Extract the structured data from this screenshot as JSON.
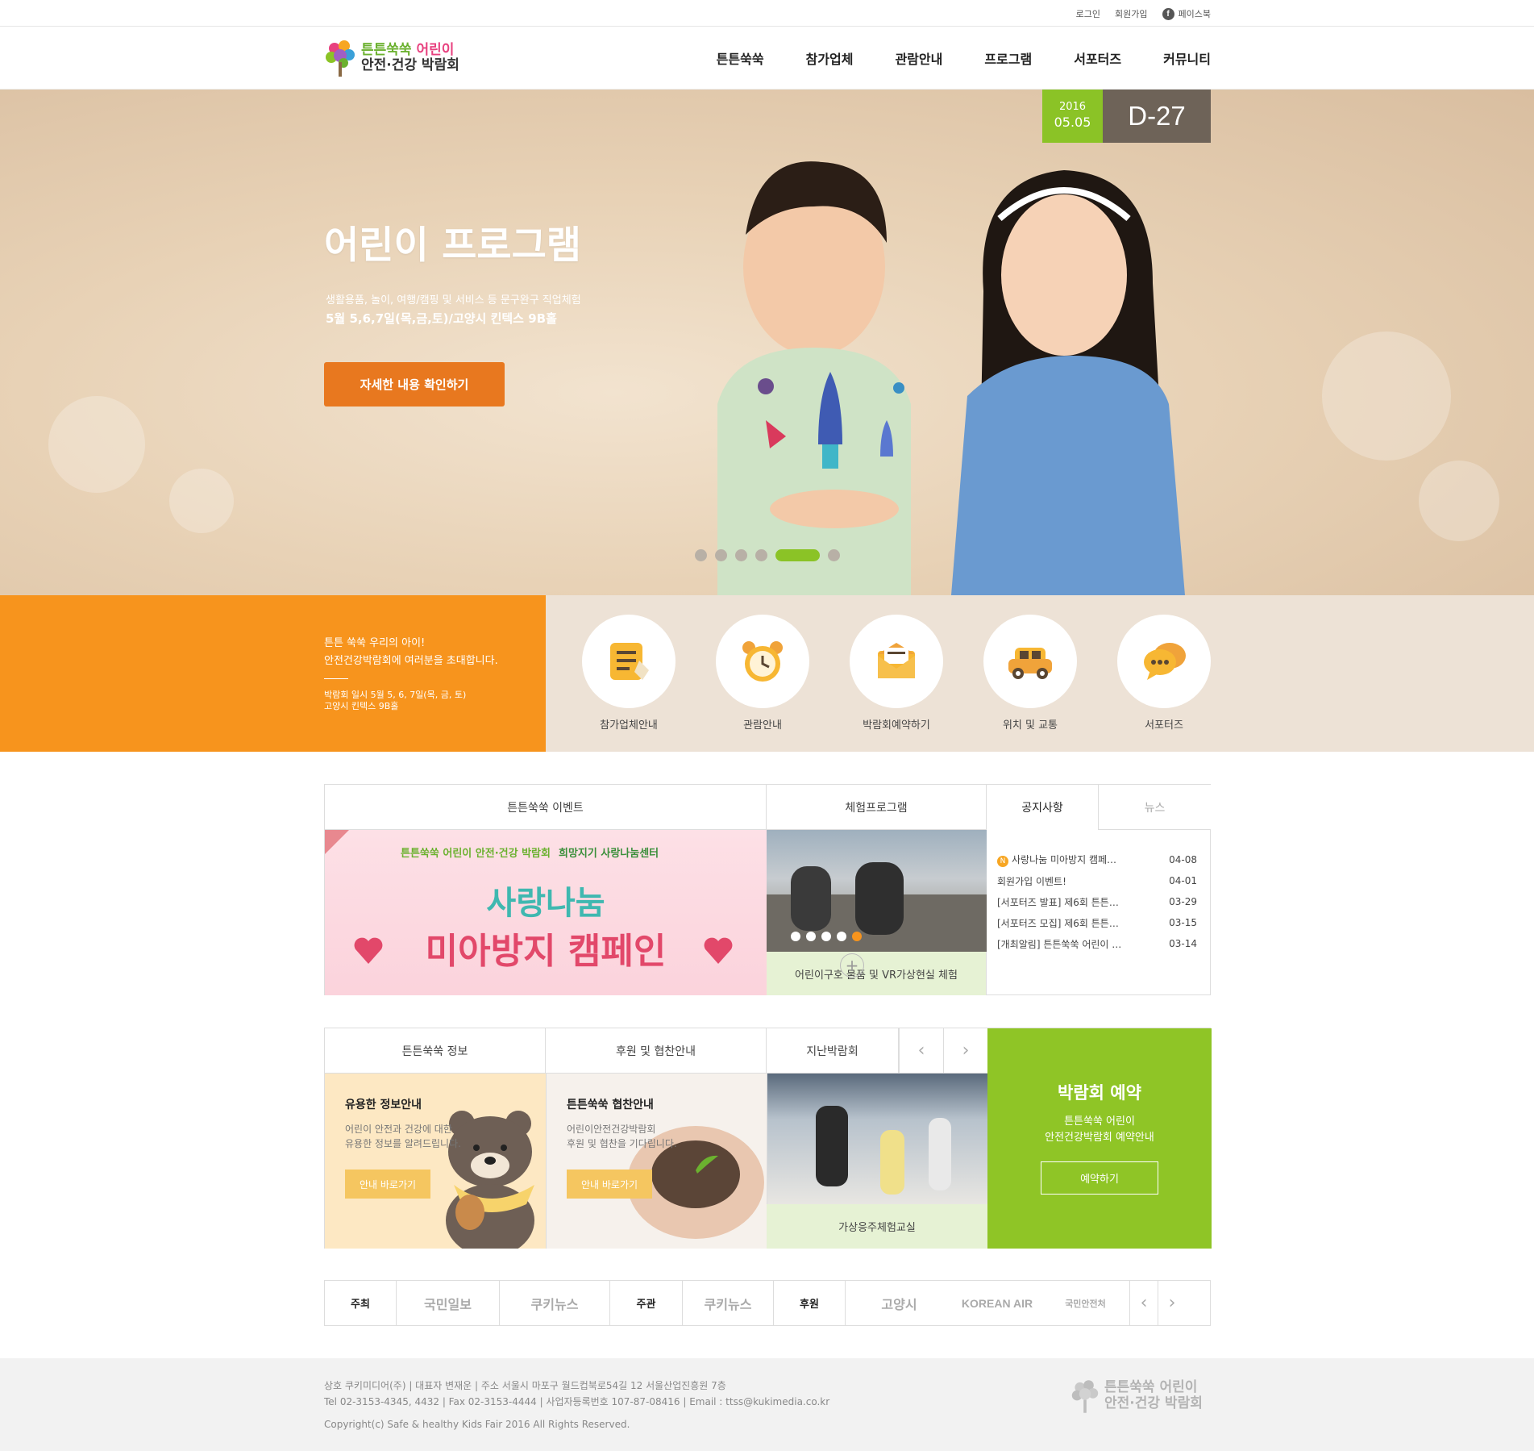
{
  "util": {
    "login": "로그인",
    "join": "회원가입",
    "facebook": "페이스북"
  },
  "logo": {
    "line1a": "튼튼쑥쑥",
    "line1b": "어린이",
    "line2": "안전·건강 박람회"
  },
  "gnb": [
    "튼튼쑥쑥",
    "참가업체",
    "관람안내",
    "프로그램",
    "서포터즈",
    "커뮤니티"
  ],
  "hero": {
    "title": "어린이 프로그램",
    "sub1": "생활용품, 놀이, 여행/캠핑 및 서비스 등 문구완구 직업체험",
    "sub2": "5월 5,6,7일(목,금,토)/고양시 킨텍스 9B홀",
    "button": "자세한 내용 확인하기",
    "dday_year": "2016",
    "dday_date": "05.05",
    "dday_count": "D-27",
    "slides_total": 6,
    "slide_active": 5
  },
  "quick": {
    "intro1": "튼튼 쑥쑥 우리의 아이!",
    "intro2": "안전건강박람회에 여러분을 초대합니다.",
    "info1": "박람회 일시 5월 5, 6, 7일(목, 금, 토)",
    "info2": "고양시 킨텍스 9B홀",
    "items": [
      "참가업체안내",
      "관람안내",
      "박람회예약하기",
      "위치 및 교통",
      "서포터즈"
    ]
  },
  "board": {
    "tab_event": "튼튼쑥쑥 이벤트",
    "tab_exp": "체험프로그램",
    "tab_notice": "공지사항",
    "tab_news": "뉴스",
    "event_header": "튼튼쑥쑥 어린이 안전·건강 박람회",
    "event_partner": "희망지기 사랑나눔센터",
    "event_title1": "사랑나눔",
    "event_title2": "미아방지 캠페인",
    "exp_caption": "어린이구호 물품 및 VR가상현실 체험",
    "notices": [
      {
        "badge": "N",
        "title": "사랑나눔 미아방지 캠페…",
        "date": "04-08"
      },
      {
        "badge": "",
        "title": "회원가입 이벤트!",
        "date": "04-01"
      },
      {
        "badge": "",
        "title": "[서포터즈 발표] 제6회 튼튼…",
        "date": "03-29"
      },
      {
        "badge": "",
        "title": "[서포터즈 모집] 제6회 튼튼…",
        "date": "03-15"
      },
      {
        "badge": "",
        "title": "[개최알림] 튼튼쑥쑥 어린이 …",
        "date": "03-14"
      }
    ]
  },
  "info": {
    "tab1": "튼튼쑥쑥 정보",
    "tab2": "후원 및 협찬안내",
    "tab3": "지난박람회",
    "card1_title": "유용한 정보안내",
    "card1_text1": "어린이 안전과 건강에 대한",
    "card1_text2": "유용한 정보를 알려드립니다.",
    "card1_btn": "안내 바로가기",
    "card2_title": "튼튼쑥쑥 협찬안내",
    "card2_text1": "어린이안전건강박람회",
    "card2_text2": "후원 및 협찬을 기다립니다.",
    "card2_btn": "안내 바로가기",
    "past_caption": "가상응주체험교실",
    "reserve_title": "박람회 예약",
    "reserve_text1": "튼튼쑥쑥 어린이",
    "reserve_text2": "안전건강박람회 예약안내",
    "reserve_btn": "예약하기"
  },
  "sponsors": {
    "host": "주최",
    "host1": "국민일보",
    "host2": "쿠키뉴스",
    "organizer": "주관",
    "org1": "쿠키뉴스",
    "support": "후원",
    "sup1": "고양시",
    "sup2": "KOREAN AIR",
    "sup3": "국민안전처"
  },
  "footer": {
    "line1": "상호 쿠키미디어(주)  |  대표자 변재운  |  주소 서울시 마포구 월드컵북로54길 12 서울산업진흥원 7층",
    "line2": "Tel 02-3153-4345, 4432  |  Fax 02-3153-4444  |  사업자등록번호 107-87-08416  |  Email : ttss@kukimedia.co.kr",
    "copy": "Copyright(c) Safe & healthy Kids Fair 2016 All Rights Reserved.",
    "logo1": "튼튼쑥쑥 어린이",
    "logo2": "안전·건강 박람회"
  },
  "colors": {
    "orange": "#f7941d",
    "green": "#8bc326",
    "button": "#e8781f",
    "dday": "#6e6358"
  }
}
